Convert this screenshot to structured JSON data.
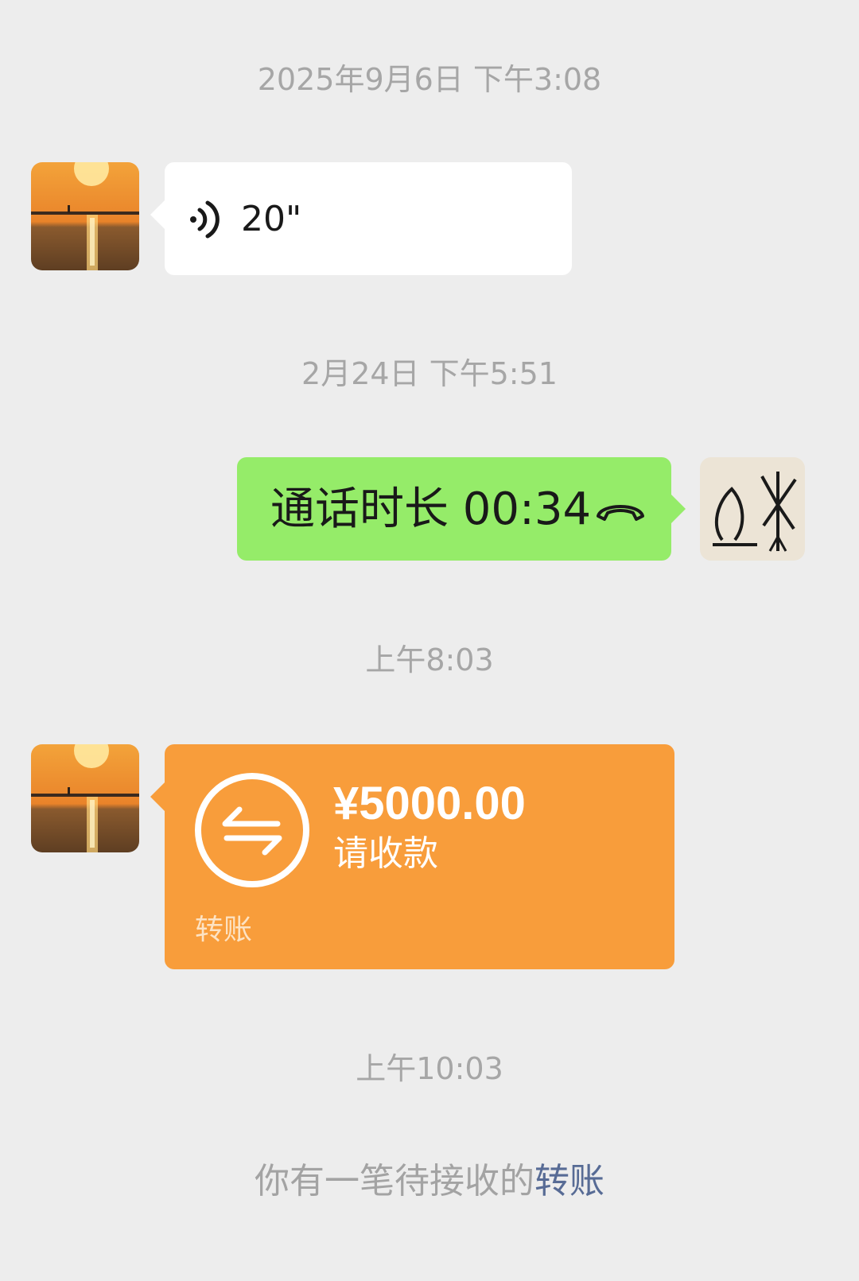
{
  "timestamps": {
    "t1": "2025年9月6日 下午3:08",
    "t2": "2月24日 下午5:51",
    "t3": "上午8:03",
    "t4": "上午10:03"
  },
  "voice_message": {
    "duration": "20\"",
    "icon": "voice-wave-icon"
  },
  "call_message": {
    "text": "通话时长 00:34",
    "icon": "phone-hangup-icon"
  },
  "transfer_message": {
    "amount": "¥5000.00",
    "status": "请收款",
    "label": "转账",
    "icon": "transfer-arrows-icon"
  },
  "system_notice": {
    "text": "你有一笔待接收的",
    "link": "转账"
  },
  "colors": {
    "background": "#ededed",
    "green_bubble": "#95ec69",
    "orange_transfer": "#f89d3b",
    "link": "#576b95"
  }
}
